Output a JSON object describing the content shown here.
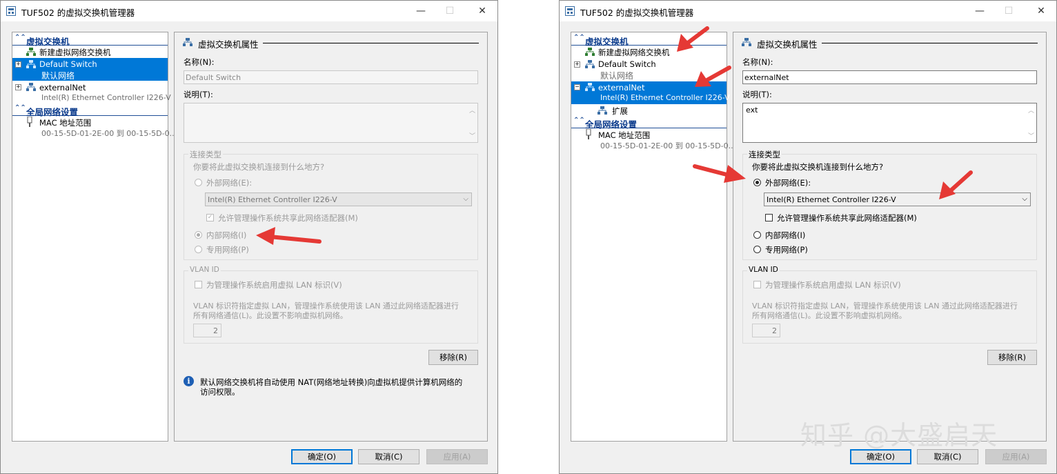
{
  "colors": {
    "accent": "#0078d7",
    "section": "#0b3b8c",
    "arrow": "#e53935",
    "disabled": "#9a9a9a"
  },
  "left": {
    "title": "TUF502 的虚拟交换机管理器",
    "tree": {
      "section1": "虚拟交换机",
      "new_switch": "新建虚拟网络交换机",
      "default_switch": {
        "name": "Default Switch",
        "sub": "默认网络"
      },
      "external_net": {
        "name": "externalNet",
        "sub": "Intel(R) Ethernet Controller I226-V"
      },
      "section2": "全局网络设置",
      "mac": {
        "name": "MAC 地址范围",
        "sub": "00-15-5D-01-2E-00 到 00-15-5D-0..."
      }
    },
    "panel": {
      "header": "虚拟交换机属性",
      "name_label": "名称(N):",
      "name_value": "Default Switch",
      "desc_label": "说明(T):",
      "desc_value": "",
      "conn_caption": "连接类型",
      "conn_question": "你要将此虚拟交换机连接到什么地方?",
      "external_radio": "外部网络(E):",
      "adapter": "Intel(R) Ethernet Controller I226-V",
      "allow_share": "允许管理操作系统共享此网络适配器(M)",
      "internal_radio": "内部网络(I)",
      "private_radio": "专用网络(P)",
      "vlan_caption": "VLAN ID",
      "vlan_check": "为管理操作系统启用虚拟 LAN 标识(V)",
      "vlan_desc1": "VLAN 标识符指定虚拟 LAN，管理操作系统使用该 LAN 通过此网络适配器进行",
      "vlan_desc2": "所有网络通信(L)。此设置不影响虚拟机网络。",
      "vlan_value": "2",
      "remove": "移除(R)",
      "info1": "默认网络交换机将自动使用 NAT(网络地址转换)向虚拟机提供计算机网络的",
      "info2": "访问权限。"
    },
    "buttons": {
      "ok": "确定(O)",
      "cancel": "取消(C)",
      "apply": "应用(A)"
    }
  },
  "right": {
    "title": "TUF502 的虚拟交换机管理器",
    "tree": {
      "section1": "虚拟交换机",
      "new_switch": "新建虚拟网络交换机",
      "default_switch": {
        "name": "Default Switch",
        "sub": "默认网络"
      },
      "external_net": {
        "name": "externalNet",
        "sub": "Intel(R) Ethernet Controller I226-V"
      },
      "extension": "扩展",
      "section2": "全局网络设置",
      "mac": {
        "name": "MAC 地址范围",
        "sub": "00-15-5D-01-2E-00 到 00-15-5D-0..."
      }
    },
    "panel": {
      "header": "虚拟交换机属性",
      "name_label": "名称(N):",
      "name_value": "externalNet",
      "desc_label": "说明(T):",
      "desc_value": "ext",
      "conn_caption": "连接类型",
      "conn_question": "你要将此虚拟交换机连接到什么地方?",
      "external_radio": "外部网络(E):",
      "adapter": "Intel(R) Ethernet Controller I226-V",
      "allow_share": "允许管理操作系统共享此网络适配器(M)",
      "internal_radio": "内部网络(I)",
      "private_radio": "专用网络(P)",
      "vlan_caption": "VLAN ID",
      "vlan_check": "为管理操作系统启用虚拟 LAN 标识(V)",
      "vlan_desc1": "VLAN 标识符指定虚拟 LAN，管理操作系统使用该 LAN 通过此网络适配器进行",
      "vlan_desc2": "所有网络通信(L)。此设置不影响虚拟机网络。",
      "vlan_value": "2",
      "remove": "移除(R)"
    },
    "buttons": {
      "ok": "确定(O)",
      "cancel": "取消(C)",
      "apply": "应用(A)"
    }
  },
  "watermark": "知乎 @大盛启天",
  "icons": {
    "window": "switch-manager-icon",
    "network": "network-switch-icon",
    "info": "info-icon",
    "mac": "usb-plug-icon",
    "close": "close-icon",
    "minimize": "minimize-icon",
    "maximize": "maximize-icon"
  }
}
